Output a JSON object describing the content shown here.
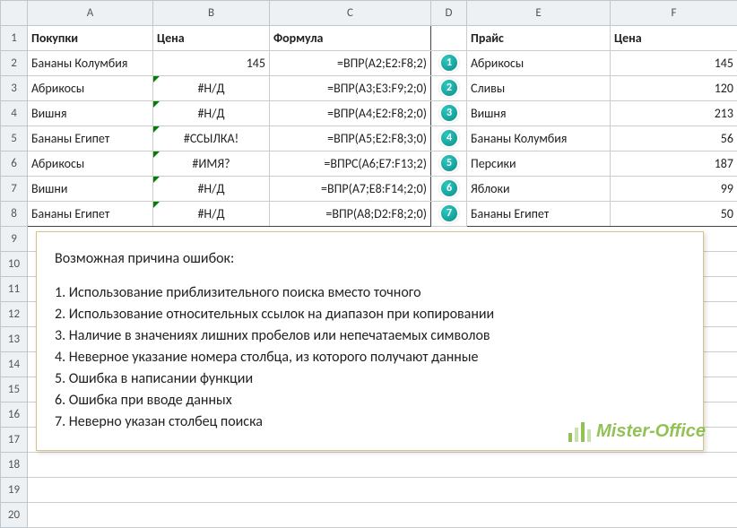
{
  "headers": {
    "A": "A",
    "B": "B",
    "C": "C",
    "D": "D",
    "E": "E",
    "F": "F"
  },
  "rownums": [
    "1",
    "2",
    "3",
    "4",
    "5",
    "6",
    "7",
    "8",
    "9",
    "10",
    "11",
    "12",
    "13",
    "14",
    "15",
    "16",
    "17",
    "18",
    "19",
    "20"
  ],
  "hdr": {
    "pokupki": "Покупки",
    "cena": "Цена",
    "formula": "Формула",
    "prais": "Прайс",
    "cena2": "Цена"
  },
  "left": [
    {
      "a": "Бананы Колумбия",
      "b": "145",
      "c": "=ВПР(A2;E2:F8;2)",
      "err": false
    },
    {
      "a": "Абрикосы",
      "b": "#Н/Д",
      "c": "=ВПР(A3;E3:F9;2;0)",
      "err": true
    },
    {
      "a": "Вишня",
      "b": "#Н/Д",
      "c": "=ВПР(A4;E2:F8;2;0)",
      "err": true
    },
    {
      "a": "Бананы Египет",
      "b": "#ССЫЛКА!",
      "c": "=ВПР(A5;E2:F8;3;0)",
      "err": true
    },
    {
      "a": "Абрикосы",
      "b": "#ИМЯ?",
      "c": "=ВПРС(A6;E7:F13;2)",
      "err": true
    },
    {
      "a": "Вишни",
      "b": "#Н/Д",
      "c": "=ВПР(A7;E8:F14;2;0)",
      "err": true
    },
    {
      "a": "Бананы Египет",
      "b": "#Н/Д",
      "c": "=ВПР(A8;D2:F8;2;0)",
      "err": true
    }
  ],
  "right": [
    {
      "e": "Абрикосы",
      "f": "145"
    },
    {
      "e": "Сливы",
      "f": "120"
    },
    {
      "e": "Вишня",
      "f": "213"
    },
    {
      "e": "Бананы Колумбия",
      "f": "56"
    },
    {
      "e": "Персики",
      "f": "187"
    },
    {
      "e": "Яблоки",
      "f": "99"
    },
    {
      "e": "Бананы Египет",
      "f": "50"
    }
  ],
  "badges": [
    "1",
    "2",
    "3",
    "4",
    "5",
    "6",
    "7"
  ],
  "reasons": {
    "title": "Возможная причина ошибок:",
    "items": [
      "1. Использование приблизительного поиска вместо точного",
      "2. Использование относительных ссылок на диапазон при копировании",
      "3. Наличие в значениях лишних пробелов или непечатаемых символов",
      "4. Неверное указание номера столбца, из которого получают данные",
      "5. Ошибка в написании функции",
      "6. Ошибка при вводе данных",
      "7. Неверно указан столбец поиска"
    ]
  },
  "watermark": "Mister-Office"
}
